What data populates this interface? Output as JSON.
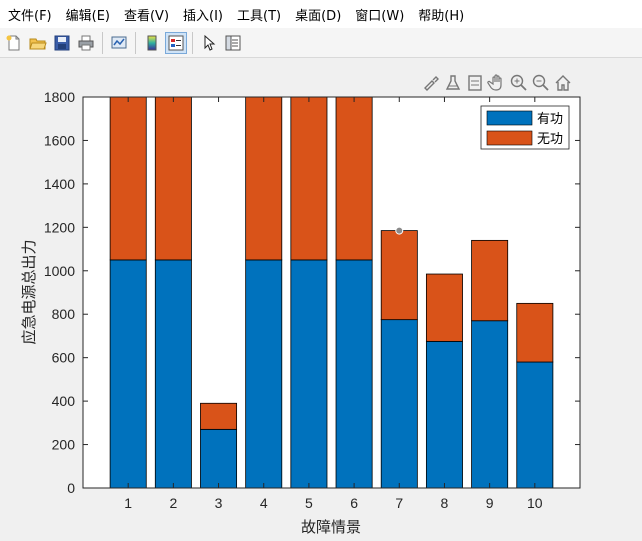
{
  "menubar": {
    "items": [
      "文件(F)",
      "编辑(E)",
      "查看(V)",
      "插入(I)",
      "工具(T)",
      "桌面(D)",
      "窗口(W)",
      "帮助(H)"
    ]
  },
  "toolbar": {
    "buttons": [
      "new-file-icon",
      "open-folder-icon",
      "save-icon",
      "print-icon",
      "link-plot-icon",
      "colorbar-icon",
      "legend-icon",
      "pointer-icon",
      "property-inspector-icon"
    ]
  },
  "axes_toolbar": {
    "buttons": [
      "brush-icon",
      "data-cursor-icon",
      "restore-view-icon",
      "pan-icon",
      "zoom-in-icon",
      "zoom-out-icon",
      "home-icon"
    ]
  },
  "colors": {
    "active": "#0072bd",
    "reactive": "#d95319"
  },
  "chart_data": {
    "type": "bar",
    "stacked": true,
    "categories": [
      "1",
      "2",
      "3",
      "4",
      "5",
      "6",
      "7",
      "8",
      "9",
      "10"
    ],
    "series": [
      {
        "name": "有功",
        "values": [
          1050,
          1050,
          270,
          1050,
          1050,
          1050,
          775,
          675,
          770,
          580
        ]
      },
      {
        "name": "无功",
        "values": [
          750,
          750,
          120,
          750,
          750,
          750,
          410,
          310,
          370,
          270
        ]
      }
    ],
    "xlabel": "故障情景",
    "ylabel": "应急电源总出力",
    "ylim": [
      0,
      1800
    ],
    "yticks": [
      0,
      200,
      400,
      600,
      800,
      1000,
      1200,
      1400,
      1600,
      1800
    ],
    "legend_position": "top-right",
    "grid": false,
    "annotations": [
      {
        "x": "7",
        "y": 1185,
        "label": "data-cursor-marker"
      }
    ]
  }
}
